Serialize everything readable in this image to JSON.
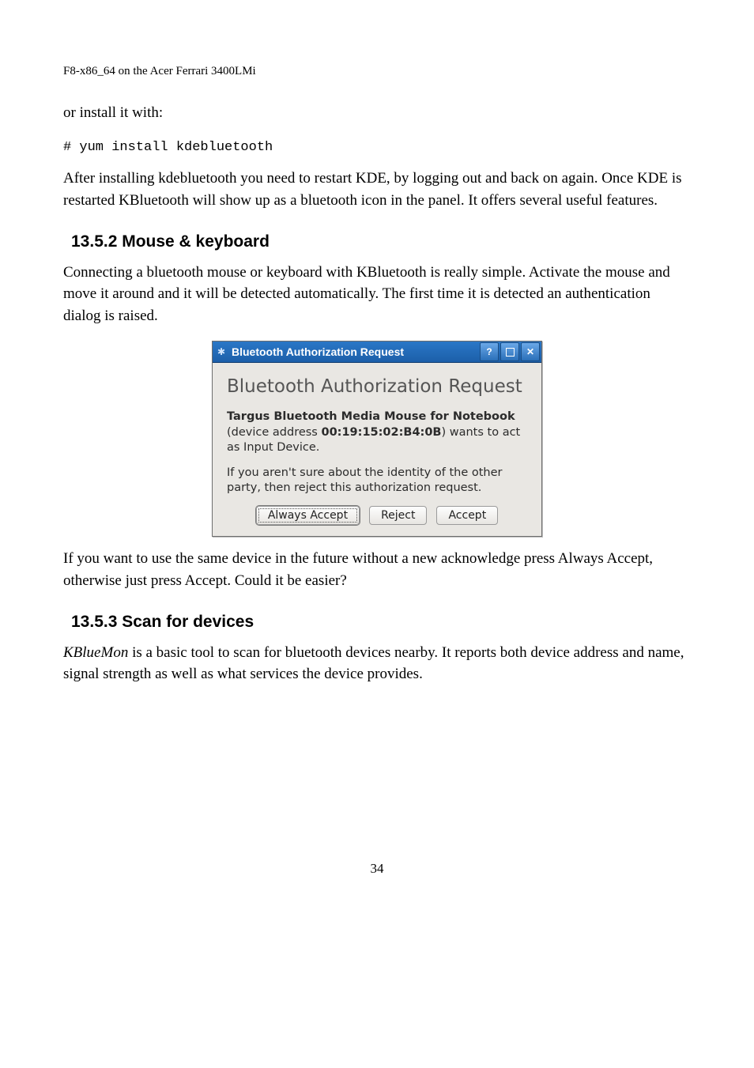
{
  "header": "F8-x86_64 on the Acer Ferrari 3400LMi",
  "para1": "or install it with:",
  "command": "# yum install kdebluetooth",
  "para2": "After installing kdebluetooth you need to restart KDE, by logging out and back on again. Once KDE is restarted KBluetooth will show up as a bluetooth icon in the panel. It offers several useful features.",
  "section1": "13.5.2 Mouse & keyboard",
  "para3": "Connecting a bluetooth mouse or keyboard with KBluetooth is really simple. Activate the mouse and move it around and it will be detected automatically. The first time it is detected an authentication dialog is raised.",
  "dialog": {
    "titlebar": "Bluetooth Authorization Request",
    "bt_icon_char": "✱",
    "help_char": "?",
    "close_char": "✕",
    "heading": "Bluetooth Authorization Request",
    "device_bold1": "Targus Bluetooth Media Mouse for Notebook",
    "device_mid": " (device address ",
    "device_bold2": "00:19:15:02:B4:0B",
    "device_tail": ") wants to act as Input Device.",
    "advice": "If you aren't sure about the identity of the other party, then reject this authorization request.",
    "btn_always": "Always Accept",
    "btn_reject": "Reject",
    "btn_accept": "Accept"
  },
  "para4": "If you want to use the same device in the future without a new acknowledge press Always Accept, otherwise just press Accept. Could it be easier?",
  "section2": "13.5.3 Scan for devices",
  "para5a": "KBlueMon",
  "para5b": " is a basic tool to scan for bluetooth devices nearby. It reports both device address and name, signal strength as well as what services the device provides.",
  "page": "34"
}
